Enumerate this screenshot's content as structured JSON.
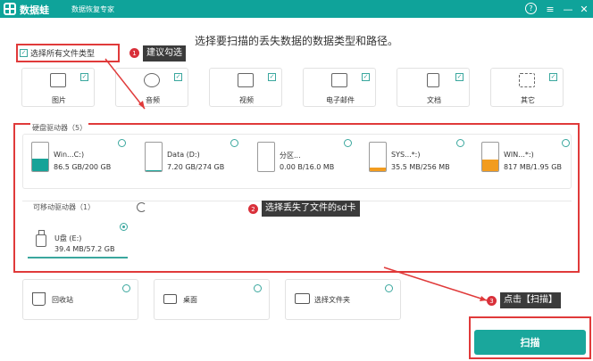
{
  "titlebar": {
    "app_name": "数据蛙",
    "subtitle": "数据恢复专家",
    "help": "?",
    "menu": "≡",
    "minimize": "—",
    "close": "✕"
  },
  "headline": "选择要扫描的丢失数据的数据类型和路径。",
  "select_all": {
    "label": "选择所有文件类型",
    "checked": true
  },
  "callouts": [
    {
      "num": "1",
      "text": "建议勾选"
    },
    {
      "num": "2",
      "text": "选择丢失了文件的sd卡"
    },
    {
      "num": "3",
      "text": "点击【扫描】"
    }
  ],
  "file_types": [
    {
      "label": "图片",
      "icon": "image-icon"
    },
    {
      "label": "音频",
      "icon": "music-icon"
    },
    {
      "label": "视频",
      "icon": "film-icon"
    },
    {
      "label": "电子邮件",
      "icon": "mail-icon"
    },
    {
      "label": "文档",
      "icon": "document-icon"
    },
    {
      "label": "其它",
      "icon": "grid-icon"
    }
  ],
  "hard_drives": {
    "title": "硬盘驱动器（5）",
    "items": [
      {
        "name": "Win...C:)",
        "size": "86.5 GB/200 GB",
        "usage": 0.43,
        "color": "#17a398"
      },
      {
        "name": "Data (D:)",
        "size": "7.20 GB/274 GB",
        "usage": 0.03,
        "color": "#17a398"
      },
      {
        "name": "分区...",
        "size": "0.00  B/16.0 MB",
        "usage": 0.0,
        "color": "#f29c1f"
      },
      {
        "name": "SYS...*:)",
        "size": "35.5 MB/256 MB",
        "usage": 0.14,
        "color": "#f29c1f"
      },
      {
        "name": "WIN...*:)",
        "size": "817 MB/1.95 GB",
        "usage": 0.42,
        "color": "#f29c1f"
      }
    ]
  },
  "removable": {
    "title": "可移动驱动器（1）",
    "items": [
      {
        "name": "U盘 (E:)",
        "size": "39.4 MB/57.2 GB",
        "selected": true
      }
    ]
  },
  "locations": [
    {
      "label": "回收站",
      "icon": "trash-icon"
    },
    {
      "label": "桌面",
      "icon": "desktop-icon"
    },
    {
      "label": "选择文件夹",
      "icon": "folder-icon"
    }
  ],
  "scan_button": "扫描",
  "colors": {
    "accent": "#1aa79c",
    "callout": "#e03a3a",
    "warning": "#f29c1f"
  }
}
